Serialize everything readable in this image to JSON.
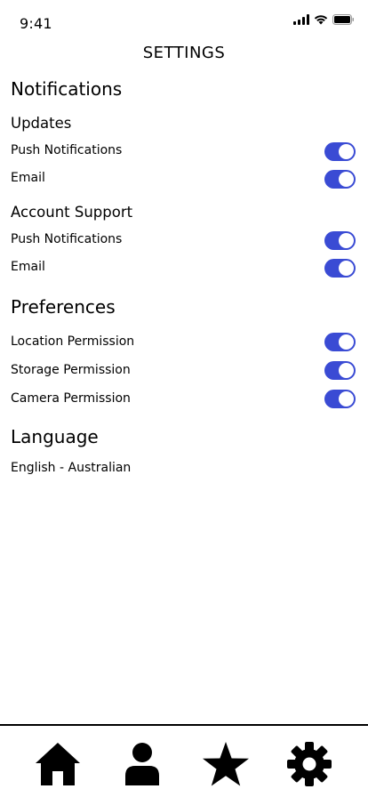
{
  "status_bar": {
    "time": "9:41",
    "icons": [
      "cellular-signal-icon",
      "wifi-icon",
      "battery-icon"
    ]
  },
  "page": {
    "title": "SETTINGS"
  },
  "notifications": {
    "heading": "Notifications",
    "updates": {
      "heading": "Updates",
      "items": [
        {
          "label": "Push Notifications",
          "enabled": true
        },
        {
          "label": "Email",
          "enabled": true
        }
      ]
    },
    "account_support": {
      "heading": "Account Support",
      "items": [
        {
          "label": "Push Notifications",
          "enabled": true
        },
        {
          "label": "Email",
          "enabled": true
        }
      ]
    }
  },
  "preferences": {
    "heading": "Preferences",
    "items": [
      {
        "label": "Location Permission",
        "enabled": true
      },
      {
        "label": "Storage Permission",
        "enabled": true
      },
      {
        "label": "Camera Permission",
        "enabled": true
      }
    ]
  },
  "language": {
    "heading": "Language",
    "value": "English - Australian"
  },
  "bottom_nav": {
    "items": [
      "home-icon",
      "profile-icon",
      "favorites-star-icon",
      "settings-gear-icon"
    ]
  },
  "colors": {
    "toggle_on": "#3a4bd4",
    "text": "#000000",
    "background": "#ffffff"
  }
}
